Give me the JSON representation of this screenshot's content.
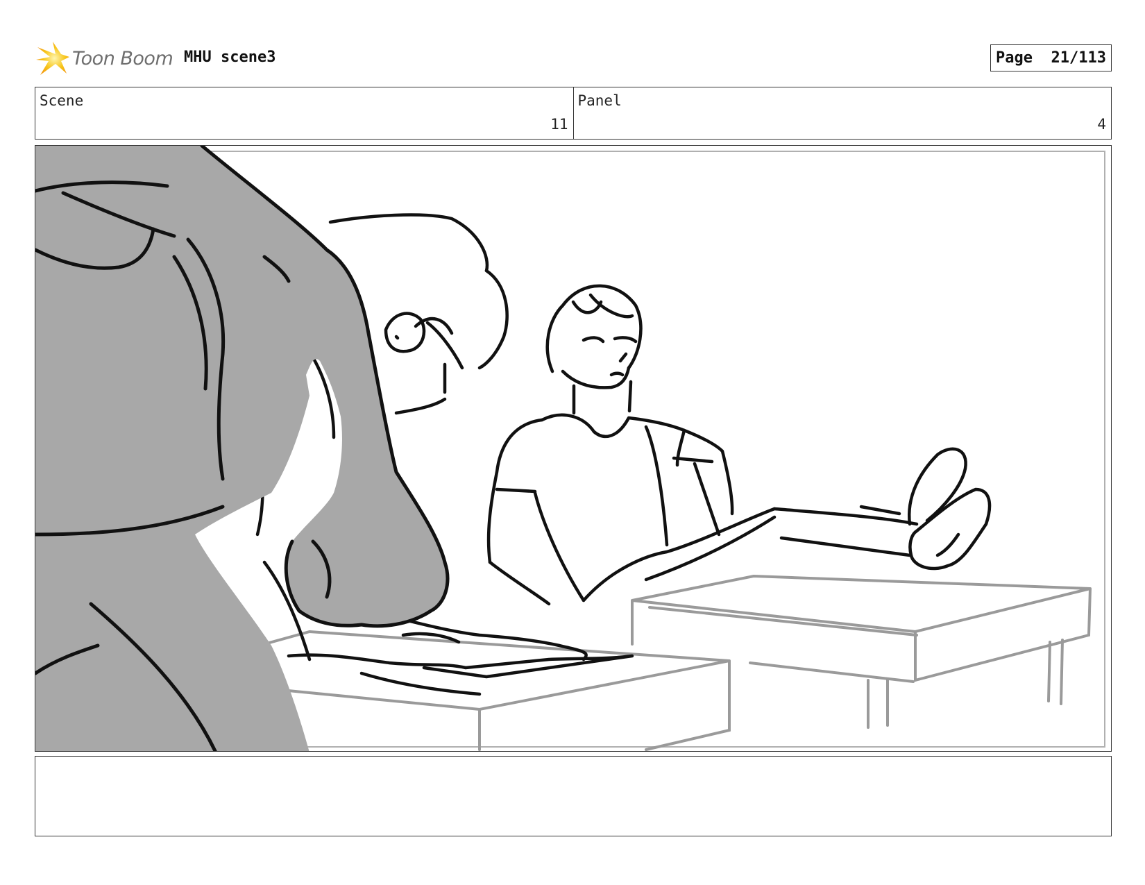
{
  "header": {
    "logo_text": "Toon Boom",
    "project_title": "MHU scene3",
    "page_label": "Page",
    "page_number": "21/113"
  },
  "info": {
    "scene_label": "Scene",
    "scene_value": "11",
    "panel_label": "Panel",
    "panel_value": "4"
  },
  "notes": {
    "text": ""
  },
  "colors": {
    "logo_star": "#f5c518",
    "ink": "#111111",
    "shadow_fill": "#a8a8a8",
    "furniture_gray": "#9a9a9a"
  },
  "icons": {
    "logo": "toon-boom-star-icon"
  }
}
